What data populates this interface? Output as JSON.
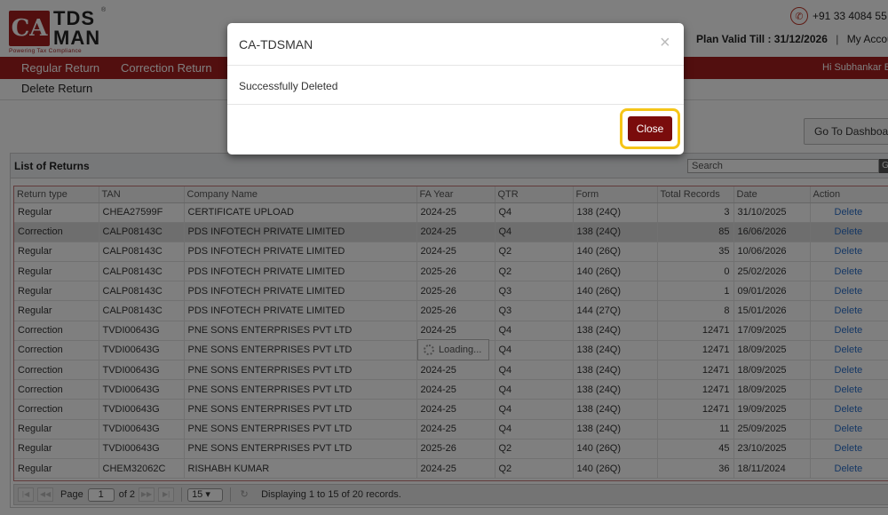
{
  "header": {
    "logo_mark": "CA",
    "logo_line1": "TDS",
    "logo_line2": "MAN",
    "logo_tagline": "Powering Tax Compliance",
    "logo_reg": "®",
    "phone": "+91 33 4084 55",
    "plan_valid": "Plan Valid Till : 31/12/2026",
    "separator": "|",
    "account_link": "My Accoun"
  },
  "nav": {
    "items": [
      "Regular Return",
      "Correction Return"
    ],
    "greeting": "Hi Subhankar B",
    "subnav_item": "Delete Return"
  },
  "dashboard_button": "Go To Dashboard",
  "grid": {
    "title": "List of Returns",
    "search_placeholder": "Search",
    "search_button": "G",
    "columns": [
      "Return type",
      "TAN",
      "Company Name",
      "FA Year",
      "QTR",
      "Form",
      "Total Records",
      "Date",
      "Action"
    ],
    "rows": [
      [
        "Regular",
        "CHEA27599F",
        "CERTIFICATE UPLOAD",
        "2024-25",
        "Q4",
        "138 (24Q)",
        "3",
        "31/10/2025",
        "Delete"
      ],
      [
        "Correction",
        "CALP08143C",
        "PDS INFOTECH PRIVATE LIMITED",
        "2024-25",
        "Q4",
        "138 (24Q)",
        "85",
        "16/06/2026",
        "Delete"
      ],
      [
        "Regular",
        "CALP08143C",
        "PDS INFOTECH PRIVATE LIMITED",
        "2024-25",
        "Q2",
        "140 (26Q)",
        "35",
        "10/06/2026",
        "Delete"
      ],
      [
        "Regular",
        "CALP08143C",
        "PDS INFOTECH PRIVATE LIMITED",
        "2025-26",
        "Q2",
        "140 (26Q)",
        "0",
        "25/02/2026",
        "Delete"
      ],
      [
        "Regular",
        "CALP08143C",
        "PDS INFOTECH PRIVATE LIMITED",
        "2025-26",
        "Q3",
        "140 (26Q)",
        "1",
        "09/01/2026",
        "Delete"
      ],
      [
        "Regular",
        "CALP08143C",
        "PDS INFOTECH PRIVATE LIMITED",
        "2025-26",
        "Q3",
        "144 (27Q)",
        "8",
        "15/01/2026",
        "Delete"
      ],
      [
        "Correction",
        "TVDI00643G",
        "PNE SONS ENTERPRISES PVT LTD",
        "2024-25",
        "Q4",
        "138 (24Q)",
        "12471",
        "17/09/2025",
        "Delete"
      ],
      [
        "Correction",
        "TVDI00643G",
        "PNE SONS ENTERPRISES PVT LTD",
        "",
        "Q4",
        "138 (24Q)",
        "12471",
        "18/09/2025",
        "Delete"
      ],
      [
        "Correction",
        "TVDI00643G",
        "PNE SONS ENTERPRISES PVT LTD",
        "2024-25",
        "Q4",
        "138 (24Q)",
        "12471",
        "18/09/2025",
        "Delete"
      ],
      [
        "Correction",
        "TVDI00643G",
        "PNE SONS ENTERPRISES PVT LTD",
        "2024-25",
        "Q4",
        "138 (24Q)",
        "12471",
        "18/09/2025",
        "Delete"
      ],
      [
        "Correction",
        "TVDI00643G",
        "PNE SONS ENTERPRISES PVT LTD",
        "2024-25",
        "Q4",
        "138 (24Q)",
        "12471",
        "19/09/2025",
        "Delete"
      ],
      [
        "Regular",
        "TVDI00643G",
        "PNE SONS ENTERPRISES PVT LTD",
        "2024-25",
        "Q4",
        "138 (24Q)",
        "11",
        "25/09/2025",
        "Delete"
      ],
      [
        "Regular",
        "TVDI00643G",
        "PNE SONS ENTERPRISES PVT LTD",
        "2025-26",
        "Q2",
        "140 (26Q)",
        "45",
        "23/10/2025",
        "Delete"
      ],
      [
        "Regular",
        "CHEM32062C",
        "RISHABH KUMAR",
        "2024-25",
        "Q2",
        "140 (26Q)",
        "36",
        "18/11/2024",
        "Delete"
      ]
    ],
    "selected_row": 1,
    "loading_text": "Loading...",
    "pager": {
      "page_label": "Page",
      "page_value": "1",
      "of_label": "of 2",
      "page_size": "15",
      "info": "Displaying 1 to 15 of 20 records."
    }
  },
  "modal": {
    "title": "CA-TDSMAN",
    "close_x": "×",
    "message": "Successfully Deleted",
    "close_button": "Close"
  },
  "colors": {
    "brand_red": "#a51f1f",
    "close_button": "#7a0c0c",
    "highlight_ring": "#f5c518",
    "link_blue": "#2a6fc9"
  },
  "icons": [
    "phone-icon",
    "close-icon",
    "loading-spinner-icon",
    "refresh-icon"
  ]
}
